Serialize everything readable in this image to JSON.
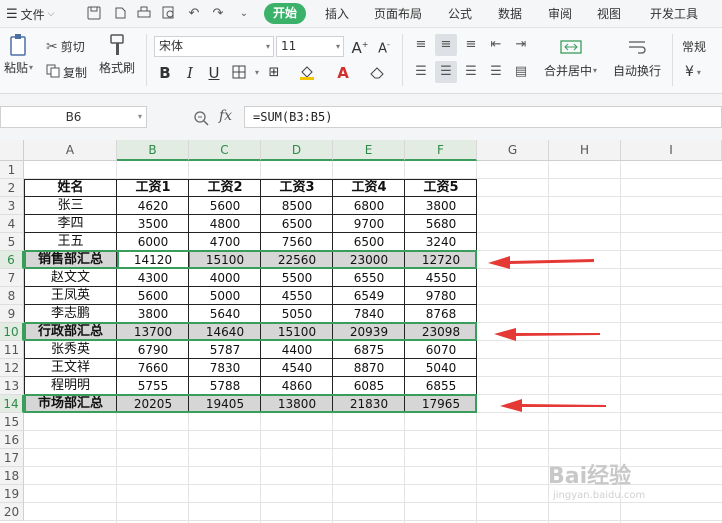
{
  "menubar": {
    "file_label": "文件",
    "tabs": [
      {
        "label": "开始",
        "active": true
      },
      {
        "label": "插入",
        "active": false
      },
      {
        "label": "页面布局",
        "active": false
      },
      {
        "label": "公式",
        "active": false
      },
      {
        "label": "数据",
        "active": false
      },
      {
        "label": "审阅",
        "active": false
      },
      {
        "label": "视图",
        "active": false
      },
      {
        "label": "开发工具",
        "active": false
      }
    ]
  },
  "ribbon": {
    "paste_label": "粘贴",
    "cut_label": "剪切",
    "copy_label": "复制",
    "format_painter_label": "格式刷",
    "font_name": "宋体",
    "font_size": "11",
    "merge_center_label": "合并居中",
    "wrap_text_label": "自动换行",
    "number_format": "常规",
    "currency_symbol": "¥"
  },
  "formula_bar": {
    "name_box": "B6",
    "fx_label": "fx",
    "formula": "=SUM(B3:B5)"
  },
  "sheet": {
    "columns": [
      "A",
      "B",
      "C",
      "D",
      "E",
      "F",
      "G",
      "H",
      "I"
    ],
    "rows": [
      "1",
      "2",
      "3",
      "4",
      "5",
      "6",
      "7",
      "8",
      "9",
      "10",
      "11",
      "12",
      "13",
      "14",
      "15",
      "16",
      "17",
      "18",
      "19",
      "20"
    ],
    "header_row": [
      "姓名",
      "工资1",
      "工资2",
      "工资3",
      "工资4",
      "工资5"
    ],
    "data": [
      [
        "张三",
        "4620",
        "5600",
        "8500",
        "6800",
        "3800"
      ],
      [
        "李四",
        "3500",
        "4800",
        "6500",
        "9700",
        "5680"
      ],
      [
        "王五",
        "6000",
        "4700",
        "7560",
        "6500",
        "3240"
      ],
      [
        "销售部汇总",
        "14120",
        "15100",
        "22560",
        "23000",
        "12720"
      ],
      [
        "赵文文",
        "4300",
        "4000",
        "5500",
        "6550",
        "4550"
      ],
      [
        "王凤英",
        "5600",
        "5000",
        "4550",
        "6549",
        "9780"
      ],
      [
        "李志鹏",
        "3800",
        "5640",
        "5050",
        "7840",
        "8768"
      ],
      [
        "行政部汇总",
        "13700",
        "14640",
        "15100",
        "20939",
        "23098"
      ],
      [
        "张秀英",
        "6790",
        "5787",
        "4400",
        "6875",
        "6070"
      ],
      [
        "王文祥",
        "7660",
        "7830",
        "4540",
        "8870",
        "5040"
      ],
      [
        "程明明",
        "5755",
        "5788",
        "4860",
        "6085",
        "6855"
      ],
      [
        "市场部汇总",
        "20205",
        "19405",
        "13800",
        "21830",
        "17965"
      ]
    ],
    "summary_rows": [
      3,
      7,
      11
    ]
  },
  "watermark": {
    "text": "Bai经验",
    "sub": "jingyan.baidu.com"
  },
  "colors": {
    "accent": "#3bb26a",
    "arrow": "#e53935",
    "summary_fill": "#d6d6d6"
  }
}
